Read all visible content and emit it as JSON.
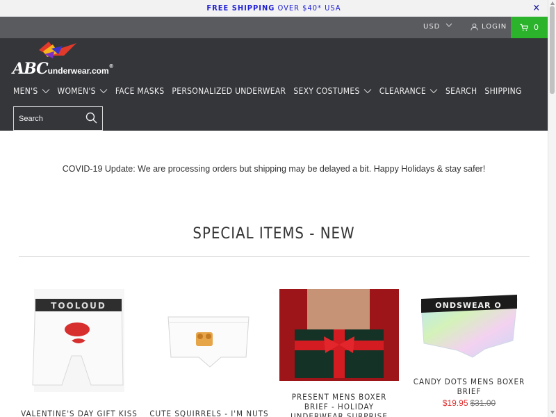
{
  "promo": {
    "strong": "FREE SHIPPING",
    "rest": "OVER $40* USA",
    "close": "✕"
  },
  "util": {
    "currency": "USD",
    "login": "LOGIN",
    "cart_count": "0"
  },
  "logo": {
    "brand": "ABC",
    "domain": "underwear.com",
    "mark": "®"
  },
  "nav": {
    "items": [
      {
        "label": "MEN'S",
        "dropdown": true
      },
      {
        "label": "WOMEN'S",
        "dropdown": true
      },
      {
        "label": "FACE MASKS",
        "dropdown": false
      },
      {
        "label": "PERSONALIZED UNDERWEAR",
        "dropdown": false
      },
      {
        "label": "SEXY COSTUMES",
        "dropdown": true
      },
      {
        "label": "CLEARANCE",
        "dropdown": true
      },
      {
        "label": "SEARCH",
        "dropdown": false
      },
      {
        "label": "SHIPPING",
        "dropdown": false
      }
    ]
  },
  "search": {
    "placeholder": "Search"
  },
  "notice": "COVID-19 Update: We are processing orders but shipping may be delayed a bit. Happy Holidays & stay safer!",
  "section": {
    "title": "SPECIAL ITEMS - NEW"
  },
  "products": [
    {
      "name": "VALENTINE'S DAY GIFT KISS ME",
      "price": "",
      "was": ""
    },
    {
      "name": "CUTE SQUIRRELS - I'M NUTS",
      "price": "",
      "was": ""
    },
    {
      "name": "PRESENT MENS BOXER BRIEF - HOLIDAY UNDERWEAR SURPRISE",
      "price": "",
      "was": ""
    },
    {
      "name": "CANDY DOTS MENS BOXER BRIEF",
      "price": "$19.95",
      "was": "$31.00"
    }
  ],
  "colors": {
    "accent_green": "#2bb32b",
    "header_bg": "#35363a",
    "util_bg": "#5a5b5f",
    "sale_red": "#e03030",
    "promo_blue": "#1f1fd4"
  }
}
